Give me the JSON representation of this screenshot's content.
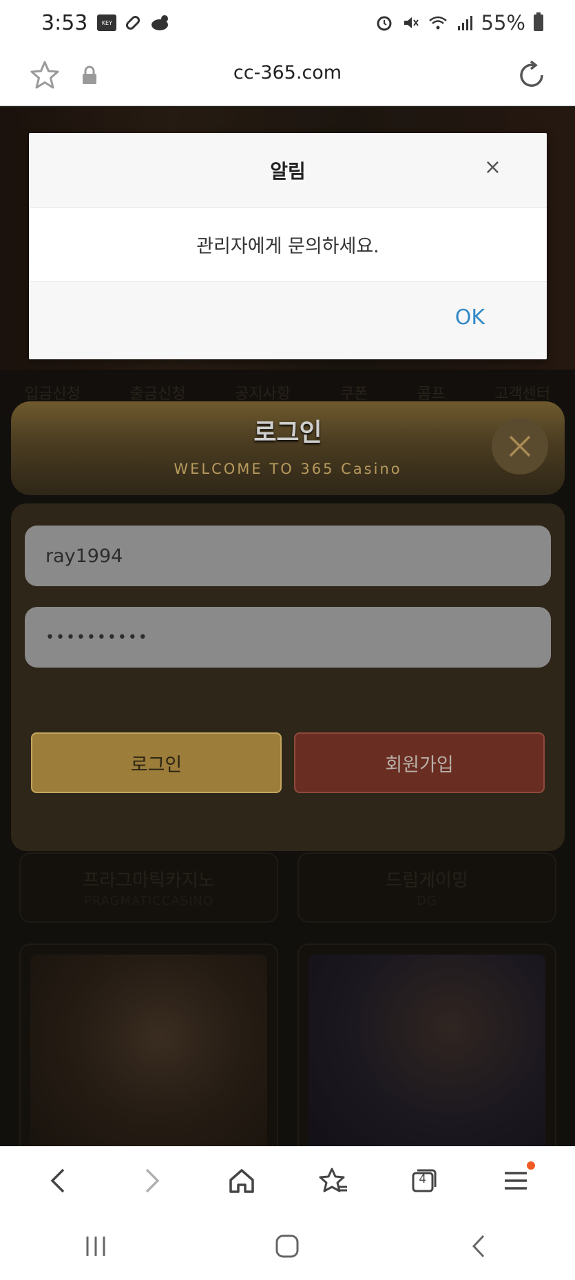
{
  "status_bar": {
    "time": "3:53",
    "key_badge": "KEY",
    "battery": "55%"
  },
  "url_bar": {
    "url": "cc-365.com"
  },
  "page": {
    "nav_items": [
      "입금신청",
      "출금신청",
      "공지사항",
      "쿠폰",
      "콤프",
      "고객센터"
    ],
    "game_cards": [
      {
        "name": "프라그마틱카지노",
        "sub": "PRAGMATICCASINO"
      },
      {
        "name": "드림게이밍",
        "sub": "DG"
      }
    ]
  },
  "login": {
    "title": "로그인",
    "subtitle": "WELCOME TO 365 Casino",
    "username": "ray1994",
    "password_mask": "••••••••••",
    "login_button": "로그인",
    "join_button": "회원가입"
  },
  "alert": {
    "title": "알림",
    "close": "×",
    "message": "관리자에게 문의하세요.",
    "ok": "OK"
  },
  "toolbar": {
    "tab_count": "4"
  },
  "colors": {
    "alert_ok": "#3289c7",
    "login_button": "#9c7d3a",
    "join_button": "#6a2d22",
    "notification_dot": "#f15a24"
  }
}
